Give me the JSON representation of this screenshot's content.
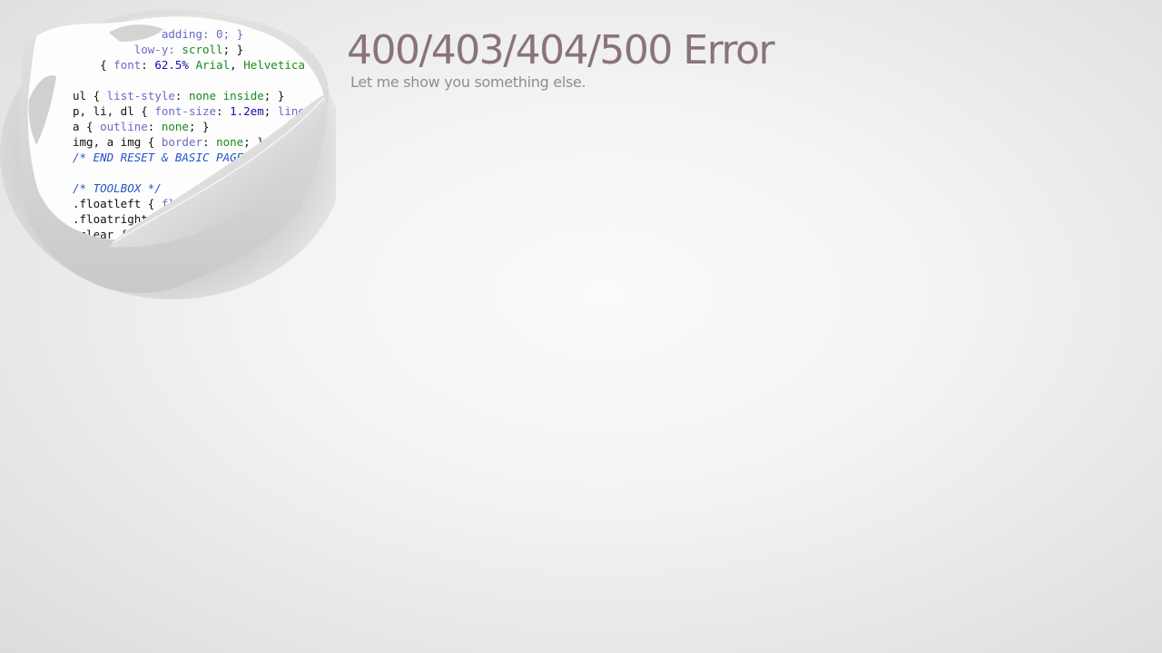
{
  "page": {
    "title": "400/403/404/500 Error",
    "subtitle": "Let me show you something else."
  },
  "illustration": {
    "icon": "torn-paper-code-icon",
    "code_lines": [
      {
        "segments": [
          {
            "text": "             adding: 0; }",
            "color": "#6a6ac8"
          }
        ]
      },
      {
        "segments": [
          {
            "text": "         low-y: ",
            "color": "#6a6ac8"
          },
          {
            "text": "scroll",
            "color": "#1a8a1a"
          },
          {
            "text": "; }",
            "color": "#111111"
          }
        ]
      },
      {
        "segments": [
          {
            "text": "    { ",
            "color": "#111111"
          },
          {
            "text": "font",
            "color": "#6a6ac8"
          },
          {
            "text": ": ",
            "color": "#111111"
          },
          {
            "text": "62.5%",
            "color": "#1111aa"
          },
          {
            "text": " Arial",
            "color": "#1a8a1a"
          },
          {
            "text": ", ",
            "color": "#111111"
          },
          {
            "text": "Helvetica",
            "color": "#1a8a1a"
          }
        ]
      },
      {
        "segments": [
          {
            "text": "",
            "color": "#111111"
          }
        ]
      },
      {
        "segments": [
          {
            "text": "ul { ",
            "color": "#111111"
          },
          {
            "text": "list-style",
            "color": "#6a6ac8"
          },
          {
            "text": ": ",
            "color": "#111111"
          },
          {
            "text": "none inside",
            "color": "#1a8a1a"
          },
          {
            "text": "; }",
            "color": "#111111"
          }
        ]
      },
      {
        "segments": [
          {
            "text": "p, li, dl { ",
            "color": "#111111"
          },
          {
            "text": "font-size",
            "color": "#6a6ac8"
          },
          {
            "text": ": ",
            "color": "#111111"
          },
          {
            "text": "1.2em",
            "color": "#1111aa"
          },
          {
            "text": "; ",
            "color": "#111111"
          },
          {
            "text": "line-h",
            "color": "#6a6ac8"
          }
        ]
      },
      {
        "segments": [
          {
            "text": "a { ",
            "color": "#111111"
          },
          {
            "text": "outline",
            "color": "#6a6ac8"
          },
          {
            "text": ": ",
            "color": "#111111"
          },
          {
            "text": "none",
            "color": "#1a8a1a"
          },
          {
            "text": "; }",
            "color": "#111111"
          }
        ]
      },
      {
        "segments": [
          {
            "text": "img, a img { ",
            "color": "#111111"
          },
          {
            "text": "border",
            "color": "#6a6ac8"
          },
          {
            "text": ": ",
            "color": "#111111"
          },
          {
            "text": "none",
            "color": "#1a8a1a"
          },
          {
            "text": "; }",
            "color": "#111111"
          }
        ]
      },
      {
        "segments": [
          {
            "text": "/* END RESET & BASIC PAGE",
            "color": "#2255cc",
            "italic": true
          }
        ]
      },
      {
        "segments": [
          {
            "text": "",
            "color": "#111111"
          }
        ]
      },
      {
        "segments": [
          {
            "text": "/* TOOLBOX */",
            "color": "#2255cc",
            "italic": true
          }
        ]
      },
      {
        "segments": [
          {
            "text": ".floatleft { ",
            "color": "#111111"
          },
          {
            "text": "fl",
            "color": "#6a6ac8"
          }
        ]
      },
      {
        "segments": [
          {
            "text": ".floatright",
            "color": "#111111"
          }
        ]
      },
      {
        "segments": [
          {
            "text": ".clear {",
            "color": "#111111"
          }
        ]
      }
    ],
    "colors": {
      "paper": "#f0f0f0",
      "hole": "#fdfdfd",
      "curl": "#d8d8d8",
      "shadow": "#9a9a9a"
    }
  },
  "theme": {
    "title_color": "#8a7479",
    "subtitle_color": "#8e8e8e"
  }
}
